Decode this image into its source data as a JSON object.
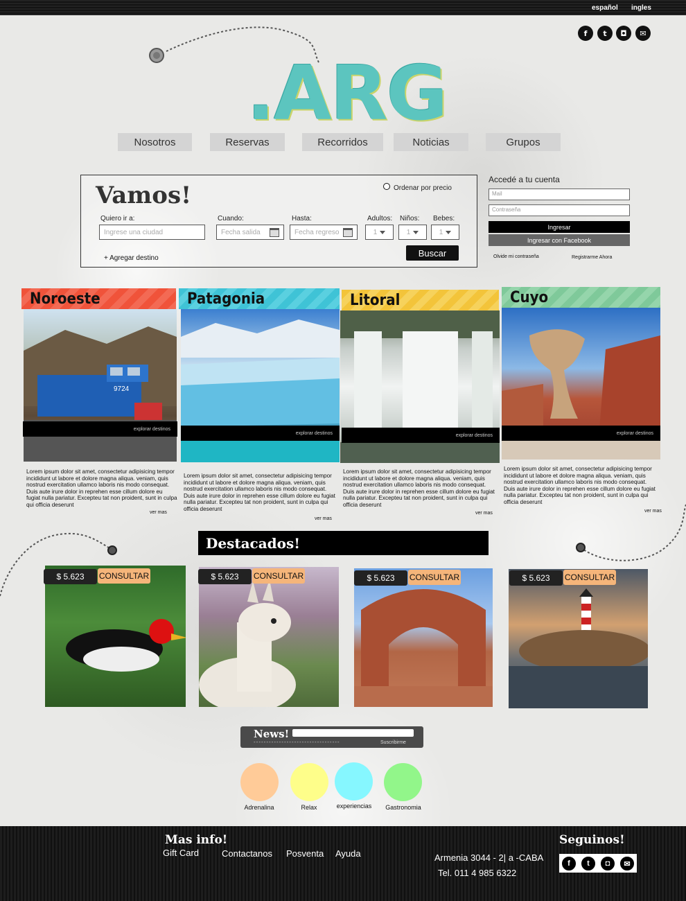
{
  "header": {
    "languages": [
      "español",
      "ingles"
    ],
    "logo_text": ".ARG",
    "social_icons": [
      "facebook-icon",
      "twitter-icon",
      "instagram-icon",
      "mail-icon"
    ]
  },
  "nav": {
    "items": [
      "Nosotros",
      "Reservas",
      "Recorridos",
      "Noticias",
      "Grupos"
    ]
  },
  "search": {
    "title": "Vamos!",
    "order_by_price": "Ordenar por precio",
    "destination_label": "Quiero ir a:",
    "destination_placeholder": "Ingrese una ciudad",
    "when_label": "Cuando:",
    "when_placeholder": "Fecha salida",
    "until_label": "Hasta:",
    "until_placeholder": "Fecha regreso",
    "adults_label": "Adultos:",
    "kids_label": "Niños:",
    "babies_label": "Bebes:",
    "adults_value": "1",
    "kids_value": "1",
    "babies_value": "1",
    "add_destination": "+ Agregar destino",
    "search_button": "Buscar"
  },
  "login": {
    "title": "Accedé a tu cuenta",
    "mail_placeholder": "Mail",
    "password_placeholder": "Contraseña",
    "login_button": "Ingresar",
    "facebook_button": "Ingresar con Facebook",
    "forgot_password": "Olvide mi contraseña",
    "register": "Registrarme Ahora"
  },
  "regions": [
    {
      "title": "Noroeste",
      "color": "#f0533a",
      "explore": "explorar destinos",
      "more": "ver mas",
      "text": "Lorem ipsum dolor sit amet, consectetur adipisicing tempor incididunt ut labore et dolore magna aliqua. veniam, quis nostrud exercitation ullamco laboris nis modo consequat. Duis aute irure dolor in reprehen esse cillum dolore eu fugiat nulla pariatur. Excepteu tat non proident, sunt in culpa qui officia deserunt"
    },
    {
      "title": "Patagonia",
      "color": "#3fc3d6",
      "explore": "explorar destinos",
      "more": "ver mas",
      "text": "Lorem ipsum dolor sit amet, consectetur adipisicing tempor incididunt ut labore et dolore magna aliqua. veniam, quis nostrud exercitation ullamco laboris nis modo consequat. Duis aute irure dolor in reprehen esse cillum dolore eu fugiat nulla pariatur. Excepteu tat non proident, sunt in culpa qui officia deserunt"
    },
    {
      "title": "Litoral",
      "color": "#f3c43a",
      "explore": "explorar destinos",
      "more": "ver mas",
      "text": "Lorem ipsum dolor sit amet, consectetur adipisicing tempor incididunt ut labore et dolore magna aliqua. veniam, quis nostrud exercitation ullamco laboris nis modo consequat. Duis aute irure dolor in reprehen esse cillum dolore eu fugiat nulla pariatur. Excepteu tat non proident, sunt in culpa qui officia deserunt"
    },
    {
      "title": "Cuyo",
      "color": "#7fc99a",
      "explore": "explorar destinos",
      "more": "ver mas",
      "text": "Lorem ipsum dolor sit amet, consectetur adipisicing tempor incididunt ut labore et dolore magna aliqua. veniam, quis nostrud exercitation ullamco laboris nis modo consequat. Duis aute irure dolor in reprehen esse cillum dolore eu fugiat nulla pariatur. Excepteu tat non proident, sunt in culpa qui officia deserunt"
    }
  ],
  "featured": {
    "title": "Destacados!",
    "items": [
      {
        "price": "$ 5.623",
        "action": "CONSULTAR",
        "image": "woodpecker-photo"
      },
      {
        "price": "$ 5.623",
        "action": "CONSULTAR",
        "image": "llama-photo"
      },
      {
        "price": "$ 5.623",
        "action": "CONSULTAR",
        "image": "rock-arch-photo"
      },
      {
        "price": "$ 5.623",
        "action": "CONSULTAR",
        "image": "lighthouse-photo"
      }
    ]
  },
  "newsletter": {
    "title": "News!",
    "dots": "----------------------------------",
    "subscribe": "Suscribirme"
  },
  "categories": [
    {
      "label": "Adrenalina",
      "color": "#ffcb98"
    },
    {
      "label": "Relax",
      "color": "#fefe8a"
    },
    {
      "label": "experiencias",
      "color": "#86f7ff"
    },
    {
      "label": "Gastronomia",
      "color": "#92f68a"
    }
  ],
  "footer": {
    "more_info_title": "Mas info!",
    "links": [
      "Gift Card",
      "Contactanos",
      "Posventa",
      "Ayuda"
    ],
    "address": "Armenia 3044 - 2| a -CABA",
    "phone": "Tel. 011 4 985 6322",
    "follow_title": "Seguinos!"
  }
}
